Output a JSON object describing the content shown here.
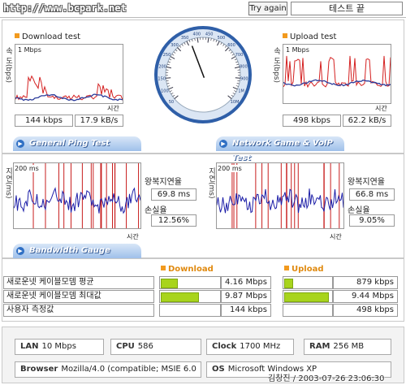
{
  "header": {
    "url": "http://www.bcpark.net",
    "try_again": "Try again",
    "test_end": "테스트 끝"
  },
  "download": {
    "title": "Download test",
    "ylabel": "속 도(bps)",
    "scale": "1 Mbps",
    "xlabel": "시간",
    "kbps": "144 kbps",
    "kBs": "17.9 kB/s"
  },
  "upload": {
    "title": "Upload test",
    "ylabel": "속 도(bps)",
    "scale": "1 Mbps",
    "xlabel": "시간",
    "kbps": "498 kbps",
    "kBs": "62.2 kB/s"
  },
  "gauge": {
    "ticks": [
      "50",
      "100",
      "150",
      "200",
      "250",
      "300",
      "350",
      "400",
      "450",
      "500",
      "600",
      "700",
      "800",
      "900",
      "1M",
      "10M"
    ],
    "needle_fraction": 0.42
  },
  "ping": {
    "banner": "General Ping Test",
    "ylabel": "지연(ms)",
    "scale": "200 ms",
    "xlabel": "시간",
    "latency_label": "왕복지연율",
    "latency": "69.8 ms",
    "loss_label": "손실율",
    "loss": "12.56%"
  },
  "game": {
    "banner": "Network Game & VoIP Test",
    "ylabel": "지연(ms)",
    "scale": "200 ms",
    "xlabel": "시간",
    "latency_label": "왕복지연율",
    "latency": "66.8 ms",
    "loss_label": "손실율",
    "loss": "9.05%"
  },
  "bandwidth": {
    "banner": "Bandwidth Gauge",
    "download_header": "Download",
    "upload_header": "Upload",
    "rows": [
      {
        "label": "새로운넷 케이블모뎀 평균",
        "download": "4.16 Mbps",
        "download_fraction": 0.26,
        "upload": "879 kbps",
        "upload_fraction": 0.15
      },
      {
        "label": "새로운넷 케이블모뎀 최대값",
        "download": "9.87 Mbps",
        "download_fraction": 0.62,
        "upload": "9.44 Mbps",
        "upload_fraction": 0.92
      },
      {
        "label": "사용자 측정값",
        "download": "144 kbps",
        "download_fraction": 0.0,
        "upload": "498 kbps",
        "upload_fraction": 0.0
      }
    ]
  },
  "system": {
    "lan_label": "LAN",
    "lan": "10 Mbps",
    "cpu_label": "CPU",
    "cpu": "586",
    "clock_label": "Clock",
    "clock": "1700 MHz",
    "ram_label": "RAM",
    "ram": "256 MB",
    "browser_label": "Browser",
    "browser": "Mozilla/4.0 (compatible; MSIE 6.0",
    "os_label": "OS",
    "os": "Microsoft Windows XP"
  },
  "watermark": "김창진 / 2003-07-26 23:06:30",
  "colors": {
    "accent": "#f29a1e",
    "bar": "#a8d41c",
    "banner": "#9fc0ea",
    "gauge_blue": "#2f5fa8"
  }
}
